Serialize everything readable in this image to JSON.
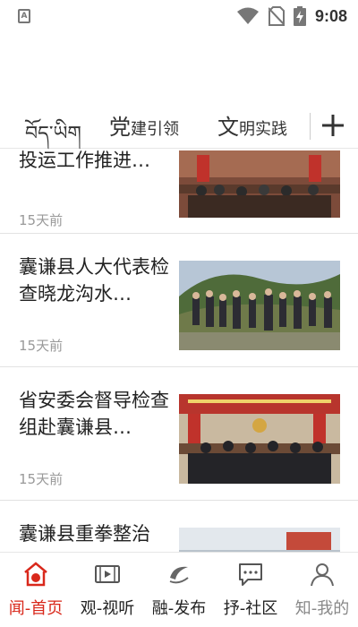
{
  "status_bar": {
    "app_icon_letter": "A",
    "time": "9:08"
  },
  "tabs": {
    "tibetan": "བོད་ཡིག",
    "items": [
      {
        "big": "党",
        "small": "建引领"
      },
      {
        "big": "文",
        "small": "明实践"
      }
    ],
    "add_symbol": "+"
  },
  "feed": {
    "items": [
      {
        "title": "投运工作推进…",
        "time": "15天前",
        "thumb": "meeting-room-photo"
      },
      {
        "title": "囊谦县人大代表检查晓龙沟水…",
        "time": "15天前",
        "thumb": "outdoor-group-photo"
      },
      {
        "title": "省安委会督导检查组赴囊谦县…",
        "time": "15天前",
        "thumb": "conference-photo"
      },
      {
        "title": "囊谦县重拳整治",
        "time": "",
        "thumb": "partial-photo"
      }
    ]
  },
  "bottom_nav": {
    "items": [
      {
        "label": "闻-首页",
        "icon": "home-icon",
        "state": "active"
      },
      {
        "label": "观-视听",
        "icon": "film-icon",
        "state": "normal"
      },
      {
        "label": "融-发布",
        "icon": "publish-icon",
        "state": "normal"
      },
      {
        "label": "抒-社区",
        "icon": "chat-icon",
        "state": "normal"
      },
      {
        "label": "知-我的",
        "icon": "user-icon",
        "state": "muted"
      }
    ]
  },
  "colors": {
    "accent": "#d9281b",
    "text": "#222222",
    "muted_text": "#999999",
    "divider": "#e2e2e2"
  }
}
